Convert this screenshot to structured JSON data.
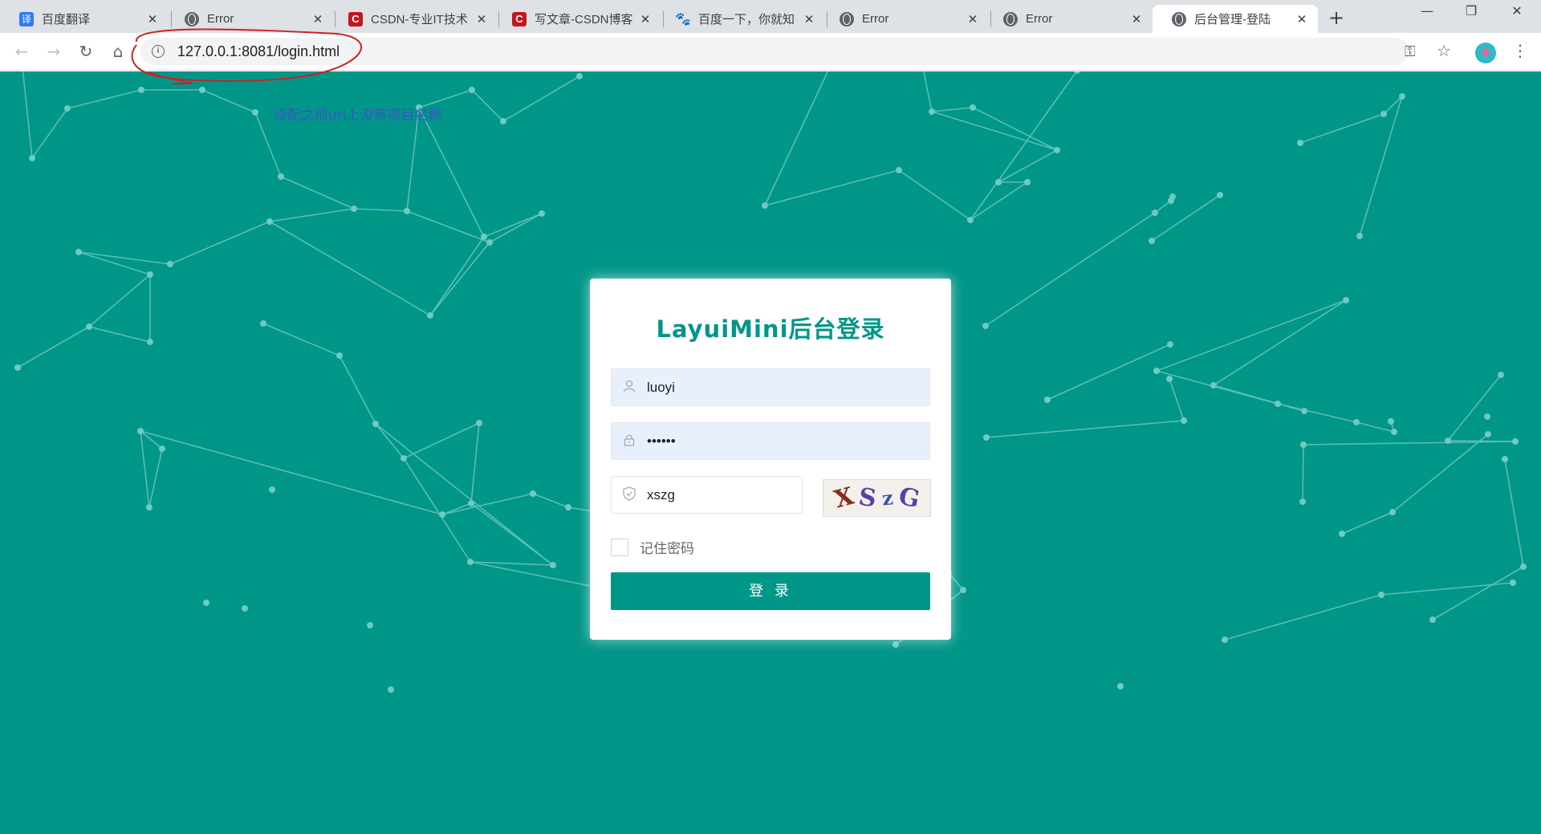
{
  "browser": {
    "tabs": [
      {
        "title": "百度翻译",
        "favicon": "baidu-fanyi-icon",
        "glyph": "译"
      },
      {
        "title": "Error",
        "favicon": "globe-icon",
        "glyph": ""
      },
      {
        "title": "CSDN-专业IT技术",
        "favicon": "csdn-icon",
        "glyph": "C"
      },
      {
        "title": "写文章-CSDN博客",
        "favicon": "csdn-icon",
        "glyph": "C"
      },
      {
        "title": "百度一下，你就知",
        "favicon": "baidu-paw-icon",
        "glyph": "🐾"
      },
      {
        "title": "Error",
        "favicon": "globe-icon",
        "glyph": ""
      },
      {
        "title": "Error",
        "favicon": "globe-icon",
        "glyph": ""
      },
      {
        "title": "后台管理-登陆",
        "favicon": "globe-icon",
        "glyph": "",
        "active": true
      }
    ],
    "close_glyph": "✕",
    "new_tab_glyph": "+",
    "window_controls": {
      "minimize": "—",
      "restore": "❐",
      "close": "✕"
    },
    "nav": {
      "back": "←",
      "forward": "→",
      "reload": "↻",
      "home": "⌂"
    },
    "url": "127.0.0.1:8081/login.html",
    "info_glyph": "i",
    "key_glyph": "⚿",
    "star_glyph": "☆",
    "menu_glyph": "⋮"
  },
  "annotation": {
    "text": "没配之前url上没有项目名称",
    "color": "#cc2222"
  },
  "login": {
    "title": "LayuiMini后台登录",
    "username": "luoyi",
    "password_mask": "••••••",
    "captcha_input": "xszg",
    "captcha_image_chars": [
      "X",
      "S",
      "z",
      "G"
    ],
    "captcha_colors": [
      "#8b2a1a",
      "#5b3fa6",
      "#3c4fb0",
      "#5b3fa6"
    ],
    "remember_label": "记住密码",
    "login_button": "登 录",
    "icons": {
      "user": "user-icon",
      "lock": "lock-icon",
      "captcha": "shield-icon"
    }
  },
  "colors": {
    "page_bg": "#009688",
    "accent": "#009688",
    "network_line": "#58bfb3",
    "network_dot": "#6fcabf"
  }
}
